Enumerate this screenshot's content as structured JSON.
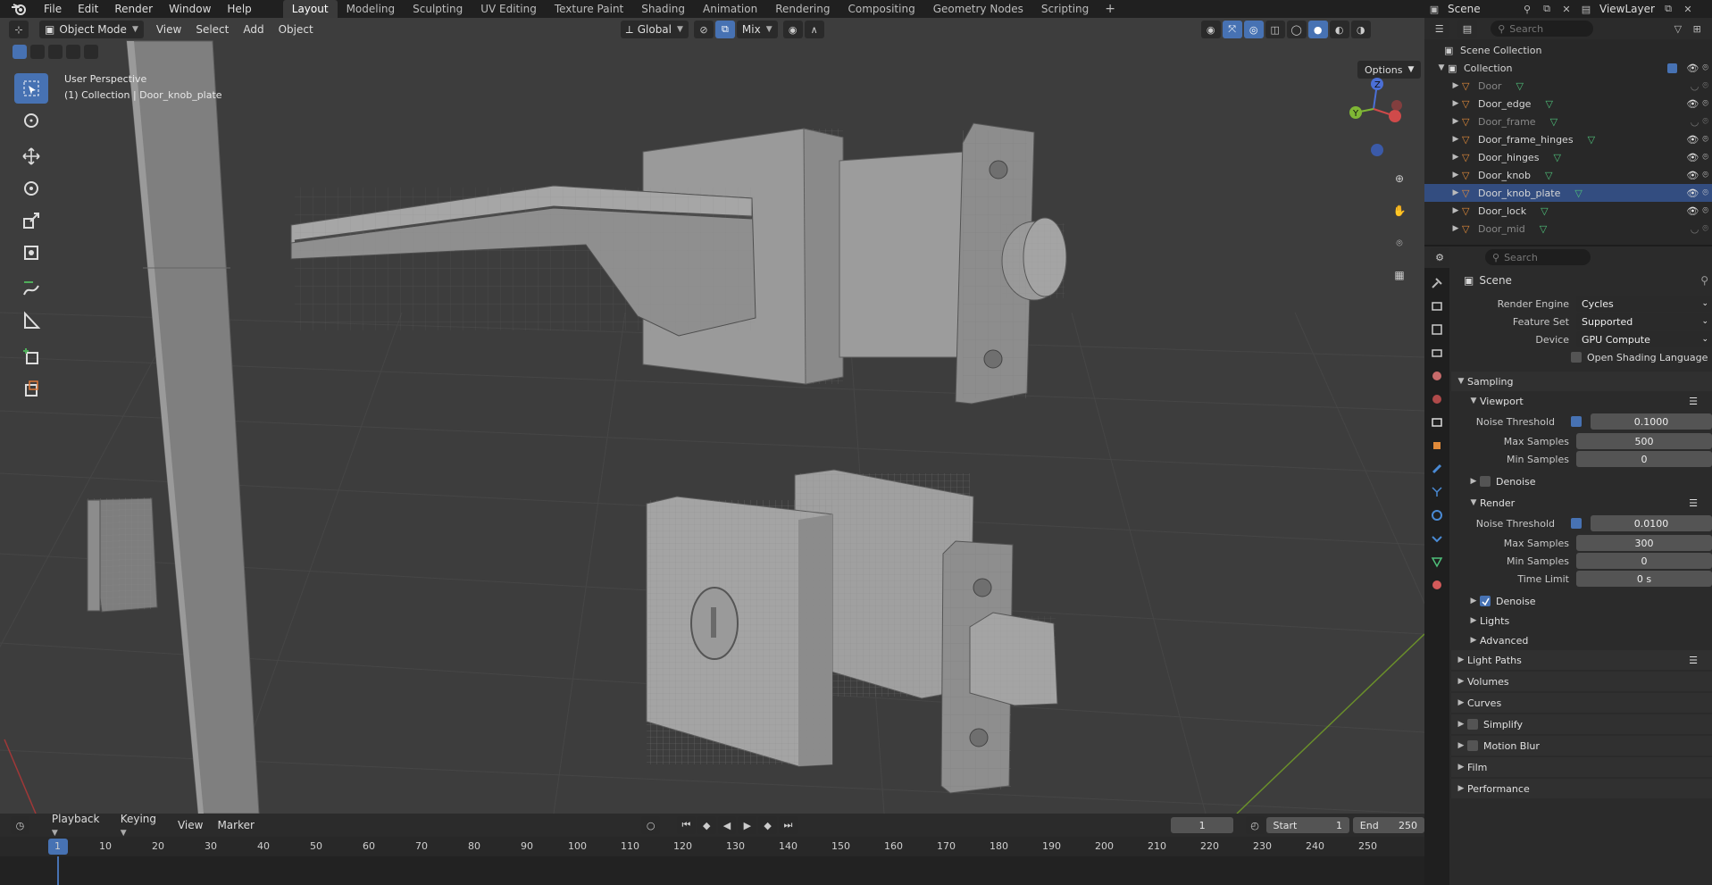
{
  "topbar": {
    "menus": [
      "File",
      "Edit",
      "Render",
      "Window",
      "Help"
    ],
    "workspaces": [
      "Layout",
      "Modeling",
      "Sculpting",
      "UV Editing",
      "Texture Paint",
      "Shading",
      "Animation",
      "Rendering",
      "Compositing",
      "Geometry Nodes",
      "Scripting"
    ],
    "active_workspace": "Layout",
    "scene_name": "Scene",
    "view_layer": "ViewLayer"
  },
  "viewport": {
    "mode": "Object Mode",
    "menus": [
      "View",
      "Select",
      "Add",
      "Object"
    ],
    "orientation": "Global",
    "snap": "Mix",
    "perspective_label": "User Perspective",
    "collection_label": "(1) Collection | Door_knob_plate",
    "options_label": "Options",
    "accent": "#4772b3"
  },
  "timeline": {
    "menus": [
      "Playback",
      "Keying",
      "View",
      "Marker"
    ],
    "current_frame": "1",
    "start_label": "Start",
    "start": "1",
    "end_label": "End",
    "end": "250",
    "ticks": [
      "1",
      "10",
      "20",
      "30",
      "40",
      "50",
      "60",
      "70",
      "80",
      "90",
      "100",
      "110",
      "120",
      "130",
      "140",
      "150",
      "160",
      "170",
      "180",
      "190",
      "200",
      "210",
      "220",
      "230",
      "240",
      "250"
    ]
  },
  "outliner": {
    "search_placeholder": "Search",
    "scene_collection": "Scene Collection",
    "collection": "Collection",
    "items": [
      {
        "name": "Door",
        "hidden": true
      },
      {
        "name": "Door_edge",
        "hidden": false
      },
      {
        "name": "Door_frame",
        "hidden": true
      },
      {
        "name": "Door_frame_hinges",
        "hidden": false
      },
      {
        "name": "Door_hinges",
        "hidden": false
      },
      {
        "name": "Door_knob",
        "hidden": false
      },
      {
        "name": "Door_knob_plate",
        "hidden": false,
        "selected": true
      },
      {
        "name": "Door_lock",
        "hidden": false
      },
      {
        "name": "Door_mid",
        "hidden": true
      }
    ]
  },
  "properties": {
    "search_placeholder": "Search",
    "context": "Scene",
    "render_engine_label": "Render Engine",
    "render_engine": "Cycles",
    "feature_set_label": "Feature Set",
    "feature_set": "Supported",
    "device_label": "Device",
    "device": "GPU Compute",
    "osl_label": "Open Shading Language",
    "sampling": "Sampling",
    "viewport_section": "Viewport",
    "noise_threshold_label": "Noise Threshold",
    "vp_noise_threshold": "0.1000",
    "max_samples_label": "Max Samples",
    "vp_max_samples": "500",
    "min_samples_label": "Min Samples",
    "vp_min_samples": "0",
    "denoise_label": "Denoise",
    "render_section": "Render",
    "r_noise_threshold": "0.0100",
    "r_max_samples": "300",
    "r_min_samples": "0",
    "time_limit_label": "Time Limit",
    "r_time_limit": "0 s",
    "lights": "Lights",
    "advanced": "Advanced",
    "light_paths": "Light Paths",
    "volumes": "Volumes",
    "curves": "Curves",
    "simplify": "Simplify",
    "motion_blur": "Motion Blur",
    "film": "Film",
    "performance": "Performance"
  }
}
